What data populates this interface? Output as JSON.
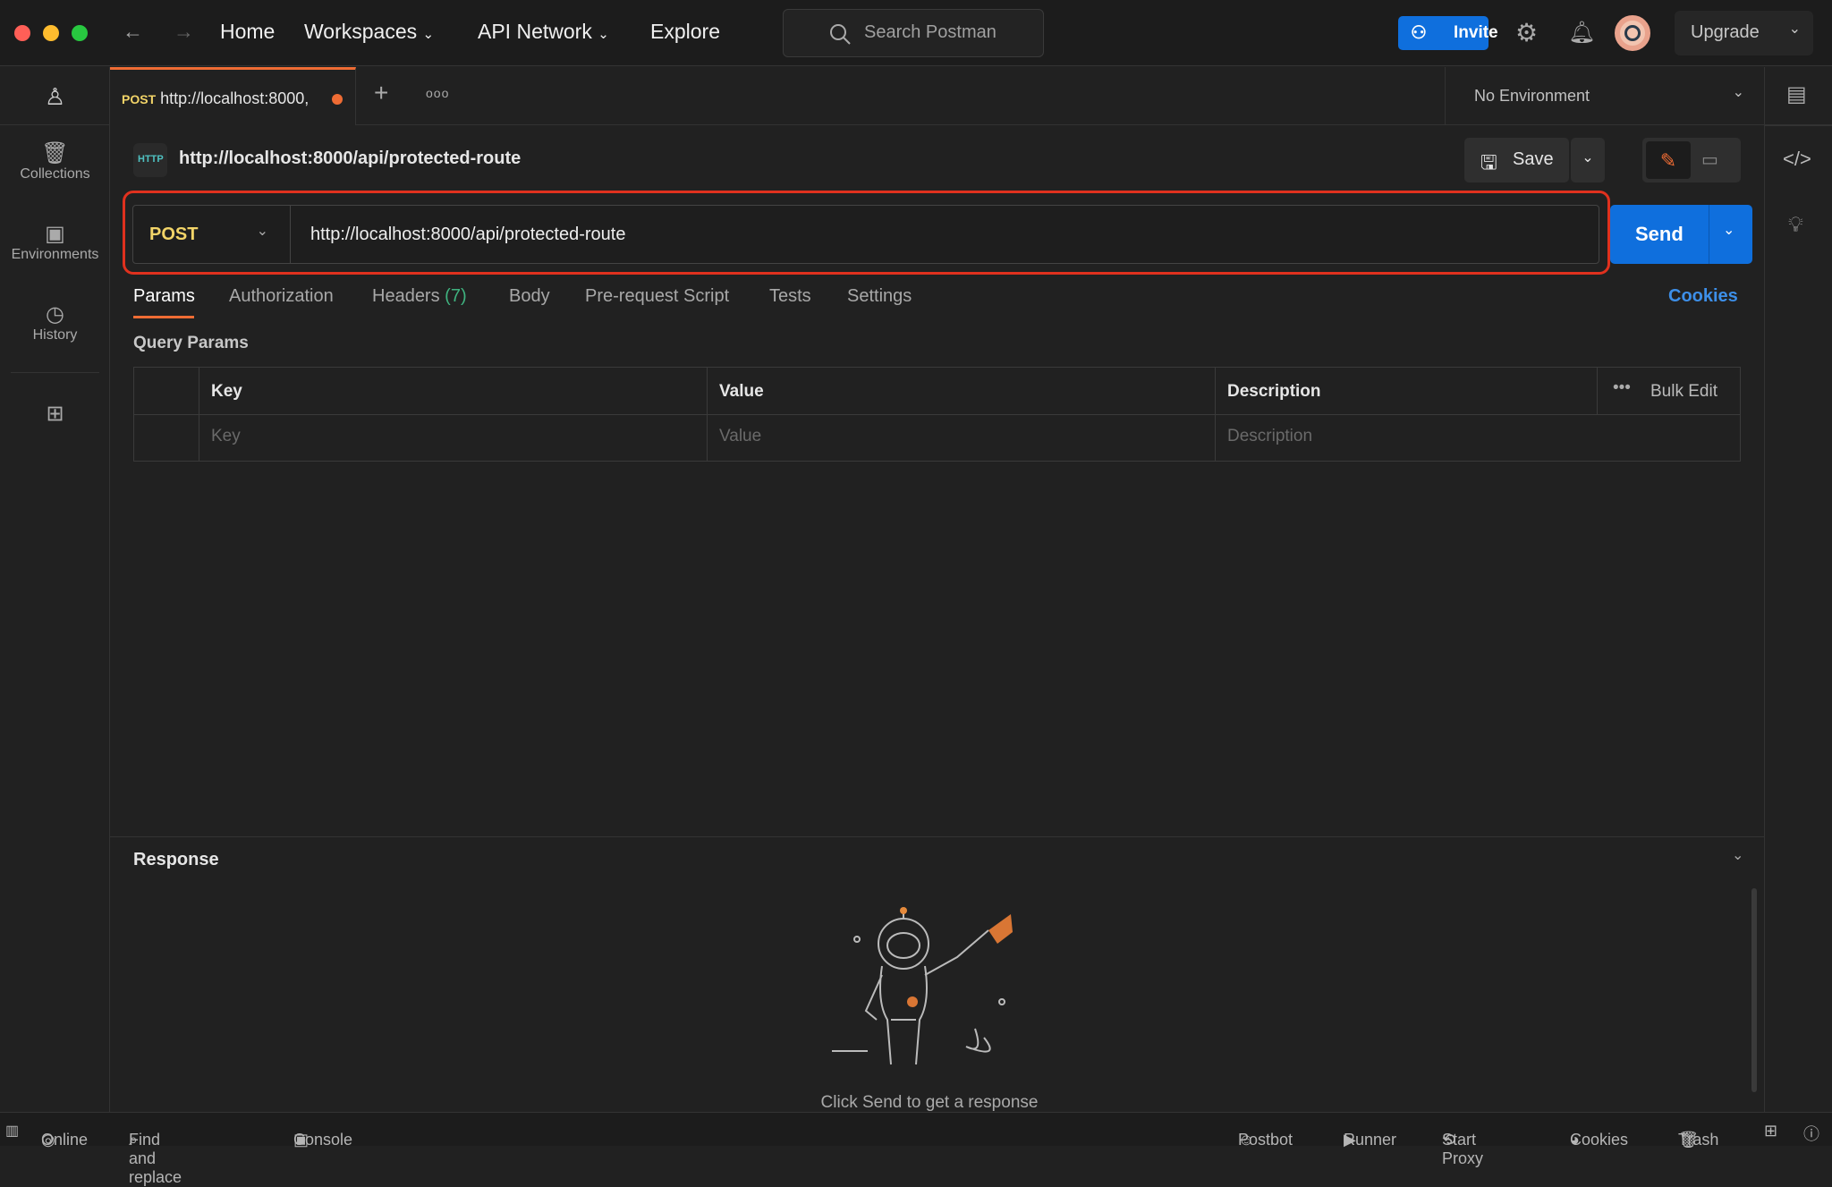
{
  "window": {
    "traffic_lights": [
      "#ff5f57",
      "#febc2e",
      "#28c840"
    ]
  },
  "topnav": {
    "home": "Home",
    "workspaces": "Workspaces",
    "api_network": "API Network",
    "explore": "Explore",
    "search_placeholder": "Search Postman",
    "invite": "Invite",
    "upgrade": "Upgrade"
  },
  "sidebar": {
    "items": [
      {
        "label": "Collections",
        "icon": "trash-can-icon"
      },
      {
        "label": "Environments",
        "icon": "environment-icon"
      },
      {
        "label": "History",
        "icon": "history-icon"
      }
    ]
  },
  "tabs": {
    "active": {
      "method": "POST",
      "title": "http://localhost:8000,",
      "unsaved": true
    }
  },
  "environment": {
    "selected": "No Environment"
  },
  "request": {
    "name": "http://localhost:8000/api/protected-route",
    "method": "POST",
    "url": "http://localhost:8000/api/protected-route",
    "save": "Save",
    "send": "Send"
  },
  "request_tabs": {
    "items": [
      "Params",
      "Authorization",
      "Headers",
      "Body",
      "Pre-request Script",
      "Tests",
      "Settings"
    ],
    "headers_count": "(7)",
    "active": "Params",
    "cookies": "Cookies"
  },
  "params": {
    "title": "Query Params",
    "headers": {
      "key": "Key",
      "value": "Value",
      "description": "Description",
      "bulk_edit": "Bulk Edit"
    },
    "placeholder": {
      "key": "Key",
      "value": "Value",
      "description": "Description"
    }
  },
  "response": {
    "title": "Response",
    "empty_text": "Click Send to get a response"
  },
  "statusbar": {
    "online": "Online",
    "find_replace": "Find and replace",
    "console": "Console",
    "postbot": "Postbot",
    "runner": "Runner",
    "start_proxy": "Start Proxy",
    "cookies": "Cookies",
    "trash": "Trash"
  },
  "colors": {
    "accent": "#0f6fdd",
    "method_post": "#f2d468",
    "tab_indicator": "#ef6c34",
    "highlight": "#e0311e"
  }
}
